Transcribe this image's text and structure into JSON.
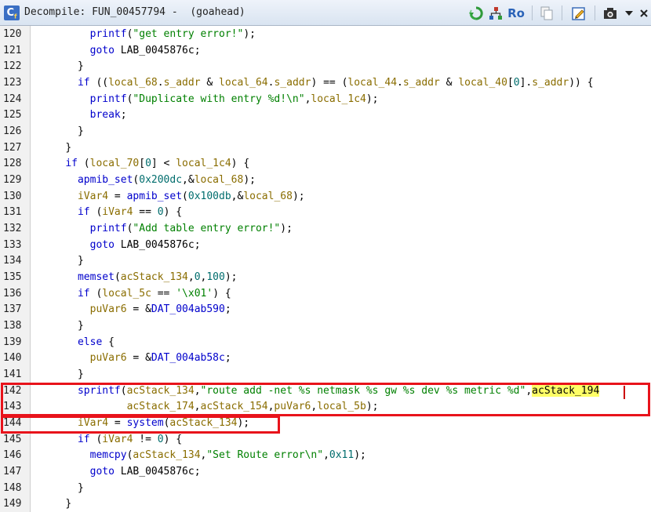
{
  "window": {
    "title": "Decompile: FUN_00457794 -  (goahead)",
    "ro_label": "Ro"
  },
  "toolbar": {
    "icons": [
      "refresh-icon",
      "graph-icon",
      "ro-icon",
      "copy-icon",
      "edit-icon",
      "snapshot-icon",
      "dropdown-icon",
      "close-icon"
    ]
  },
  "colors": {
    "function": "#0000cc",
    "keyword": "#0000cc",
    "string": "#008000",
    "variable": "#8a6d00",
    "number": "#006d6d",
    "highlight": "#ffff66",
    "annotation_box": "#e8131b"
  },
  "code_lines": [
    {
      "n": "120",
      "indent": "        ",
      "tokens": [
        [
          "fn",
          "printf"
        ],
        [
          "p",
          "("
        ],
        [
          "str",
          "\"get entry error!\""
        ],
        [
          "p",
          ");"
        ]
      ]
    },
    {
      "n": "121",
      "indent": "        ",
      "tokens": [
        [
          "kw",
          "goto"
        ],
        [
          "p",
          " "
        ],
        [
          "lbl",
          "LAB_0045876c"
        ],
        [
          "p",
          ";"
        ]
      ]
    },
    {
      "n": "122",
      "indent": "      ",
      "tokens": [
        [
          "p",
          "}"
        ]
      ]
    },
    {
      "n": "123",
      "indent": "      ",
      "tokens": [
        [
          "kw",
          "if"
        ],
        [
          "p",
          " (("
        ],
        [
          "var",
          "local_68"
        ],
        [
          "p",
          "."
        ],
        [
          "var",
          "s_addr"
        ],
        [
          "p",
          " & "
        ],
        [
          "var",
          "local_64"
        ],
        [
          "p",
          "."
        ],
        [
          "var",
          "s_addr"
        ],
        [
          "p",
          ") == ("
        ],
        [
          "var",
          "local_44"
        ],
        [
          "p",
          "."
        ],
        [
          "var",
          "s_addr"
        ],
        [
          "p",
          " & "
        ],
        [
          "var",
          "local_40"
        ],
        [
          "p",
          "["
        ],
        [
          "num",
          "0"
        ],
        [
          "p",
          "]."
        ],
        [
          "var",
          "s_addr"
        ],
        [
          "p",
          ")) {"
        ]
      ]
    },
    {
      "n": "124",
      "indent": "        ",
      "tokens": [
        [
          "fn",
          "printf"
        ],
        [
          "p",
          "("
        ],
        [
          "str",
          "\"Duplicate with entry %d!\\n\""
        ],
        [
          "p",
          ","
        ],
        [
          "var",
          "local_1c4"
        ],
        [
          "p",
          ");"
        ]
      ]
    },
    {
      "n": "125",
      "indent": "        ",
      "tokens": [
        [
          "kw",
          "break"
        ],
        [
          "p",
          ";"
        ]
      ]
    },
    {
      "n": "126",
      "indent": "      ",
      "tokens": [
        [
          "p",
          "}"
        ]
      ]
    },
    {
      "n": "127",
      "indent": "    ",
      "tokens": [
        [
          "p",
          "}"
        ]
      ]
    },
    {
      "n": "128",
      "indent": "    ",
      "tokens": [
        [
          "kw",
          "if"
        ],
        [
          "p",
          " ("
        ],
        [
          "var",
          "local_70"
        ],
        [
          "p",
          "["
        ],
        [
          "num",
          "0"
        ],
        [
          "p",
          "] < "
        ],
        [
          "var",
          "local_1c4"
        ],
        [
          "p",
          ") {"
        ]
      ]
    },
    {
      "n": "129",
      "indent": "      ",
      "tokens": [
        [
          "fn",
          "apmib_set"
        ],
        [
          "p",
          "("
        ],
        [
          "num",
          "0x200dc"
        ],
        [
          "p",
          ",&"
        ],
        [
          "var",
          "local_68"
        ],
        [
          "p",
          ");"
        ]
      ]
    },
    {
      "n": "130",
      "indent": "      ",
      "tokens": [
        [
          "var",
          "iVar4"
        ],
        [
          "p",
          " = "
        ],
        [
          "fn",
          "apmib_set"
        ],
        [
          "p",
          "("
        ],
        [
          "num",
          "0x100db"
        ],
        [
          "p",
          ",&"
        ],
        [
          "var",
          "local_68"
        ],
        [
          "p",
          ");"
        ]
      ]
    },
    {
      "n": "131",
      "indent": "      ",
      "tokens": [
        [
          "kw",
          "if"
        ],
        [
          "p",
          " ("
        ],
        [
          "var",
          "iVar4"
        ],
        [
          "p",
          " == "
        ],
        [
          "num",
          "0"
        ],
        [
          "p",
          ") {"
        ]
      ]
    },
    {
      "n": "132",
      "indent": "        ",
      "tokens": [
        [
          "fn",
          "printf"
        ],
        [
          "p",
          "("
        ],
        [
          "str",
          "\"Add table entry error!\""
        ],
        [
          "p",
          ");"
        ]
      ]
    },
    {
      "n": "133",
      "indent": "        ",
      "tokens": [
        [
          "kw",
          "goto"
        ],
        [
          "p",
          " "
        ],
        [
          "lbl",
          "LAB_0045876c"
        ],
        [
          "p",
          ";"
        ]
      ]
    },
    {
      "n": "134",
      "indent": "      ",
      "tokens": [
        [
          "p",
          "}"
        ]
      ]
    },
    {
      "n": "135",
      "indent": "      ",
      "tokens": [
        [
          "fn",
          "memset"
        ],
        [
          "p",
          "("
        ],
        [
          "var",
          "acStack_134"
        ],
        [
          "p",
          ","
        ],
        [
          "num",
          "0"
        ],
        [
          "p",
          ","
        ],
        [
          "num",
          "100"
        ],
        [
          "p",
          ");"
        ]
      ]
    },
    {
      "n": "136",
      "indent": "      ",
      "tokens": [
        [
          "kw",
          "if"
        ],
        [
          "p",
          " ("
        ],
        [
          "var",
          "local_5c"
        ],
        [
          "p",
          " == "
        ],
        [
          "str",
          "'\\x01'"
        ],
        [
          "p",
          ") {"
        ]
      ]
    },
    {
      "n": "137",
      "indent": "        ",
      "tokens": [
        [
          "var",
          "puVar6"
        ],
        [
          "p",
          " = &"
        ],
        [
          "gl",
          "DAT_004ab590"
        ],
        [
          "p",
          ";"
        ]
      ]
    },
    {
      "n": "138",
      "indent": "      ",
      "tokens": [
        [
          "p",
          "}"
        ]
      ]
    },
    {
      "n": "139",
      "indent": "      ",
      "tokens": [
        [
          "kw",
          "else"
        ],
        [
          "p",
          " {"
        ]
      ]
    },
    {
      "n": "140",
      "indent": "        ",
      "tokens": [
        [
          "var",
          "puVar6"
        ],
        [
          "p",
          " = &"
        ],
        [
          "gl",
          "DAT_004ab58c"
        ],
        [
          "p",
          ";"
        ]
      ]
    },
    {
      "n": "141",
      "indent": "      ",
      "tokens": [
        [
          "p",
          "}"
        ]
      ]
    },
    {
      "n": "142",
      "indent": "      ",
      "tokens": [
        [
          "fn",
          "sprintf"
        ],
        [
          "p",
          "("
        ],
        [
          "var",
          "acStack_134"
        ],
        [
          "p",
          ","
        ],
        [
          "str",
          "\"route add -net %s netmask %s gw %s dev %s metric %d\""
        ],
        [
          "p",
          ","
        ],
        [
          "hl",
          "acStack_194"
        ]
      ]
    },
    {
      "n": "143",
      "indent": "              ",
      "tokens": [
        [
          "var",
          "acStack_174"
        ],
        [
          "p",
          ","
        ],
        [
          "var",
          "acStack_154"
        ],
        [
          "p",
          ","
        ],
        [
          "var",
          "puVar6"
        ],
        [
          "p",
          ","
        ],
        [
          "var",
          "local_5b"
        ],
        [
          "p",
          ");"
        ]
      ]
    },
    {
      "n": "144",
      "indent": "      ",
      "tokens": [
        [
          "var",
          "iVar4"
        ],
        [
          "p",
          " = "
        ],
        [
          "fn",
          "system"
        ],
        [
          "p",
          "("
        ],
        [
          "var",
          "acStack_134"
        ],
        [
          "p",
          ");"
        ]
      ]
    },
    {
      "n": "145",
      "indent": "      ",
      "tokens": [
        [
          "kw",
          "if"
        ],
        [
          "p",
          " ("
        ],
        [
          "var",
          "iVar4"
        ],
        [
          "p",
          " != "
        ],
        [
          "num",
          "0"
        ],
        [
          "p",
          ") {"
        ]
      ]
    },
    {
      "n": "146",
      "indent": "        ",
      "tokens": [
        [
          "fn",
          "memcpy"
        ],
        [
          "p",
          "("
        ],
        [
          "var",
          "acStack_134"
        ],
        [
          "p",
          ","
        ],
        [
          "str",
          "\"Set Route error\\n\""
        ],
        [
          "p",
          ","
        ],
        [
          "num",
          "0x11"
        ],
        [
          "p",
          ");"
        ]
      ]
    },
    {
      "n": "147",
      "indent": "        ",
      "tokens": [
        [
          "kw",
          "goto"
        ],
        [
          "p",
          " "
        ],
        [
          "lbl",
          "LAB_0045876c"
        ],
        [
          "p",
          ";"
        ]
      ]
    },
    {
      "n": "148",
      "indent": "      ",
      "tokens": [
        [
          "p",
          "}"
        ]
      ]
    },
    {
      "n": "149",
      "indent": "    ",
      "tokens": [
        [
          "p",
          "}"
        ]
      ]
    }
  ]
}
